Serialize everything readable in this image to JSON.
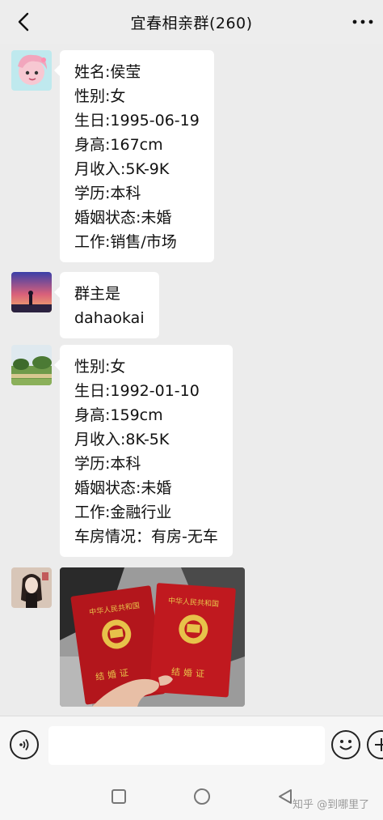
{
  "header": {
    "title": "宜春相亲群(260)",
    "back_icon": "chevron-left-icon",
    "more_icon": "more-dots-icon"
  },
  "messages": [
    {
      "avatar": "anime-girl-avatar",
      "lines": [
        "姓名:侯莹",
        "性别:女",
        "生日:1995-06-19",
        "身高:167cm",
        "月收入:5K-9K",
        "学历:本科",
        "婚姻状态:未婚",
        "工作:销售/市场"
      ]
    },
    {
      "avatar": "sunset-silhouette-avatar",
      "lines": [
        "群主是",
        "dahaokai"
      ]
    },
    {
      "avatar": "park-landscape-avatar",
      "lines": [
        "性别:女",
        "生日:1992-01-10",
        "身高:159cm",
        "月收入:8K-5K",
        "学历:本科",
        "婚姻状态:未婚",
        "工作:金融行业",
        "车房情况：有房-无车"
      ]
    },
    {
      "avatar": "woman-drawing-avatar",
      "image": {
        "description_icon": "marriage-certificates-photo",
        "cert_header": "中华人民共和国",
        "cert_title": "结婚证"
      }
    }
  ],
  "input_bar": {
    "voice_icon": "voice-icon",
    "emoji_icon": "emoji-icon",
    "plus_icon": "plus-icon",
    "text_value": ""
  },
  "nav": {
    "square_icon": "recent-apps-icon",
    "circle_icon": "home-icon",
    "triangle_icon": "back-triangle-icon"
  },
  "watermark": "知乎 @到哪里了",
  "colors": {
    "background": "#ececec",
    "bubble": "#ffffff",
    "certificate_red": "#b3161c",
    "certificate_gold": "#e7c24a"
  }
}
